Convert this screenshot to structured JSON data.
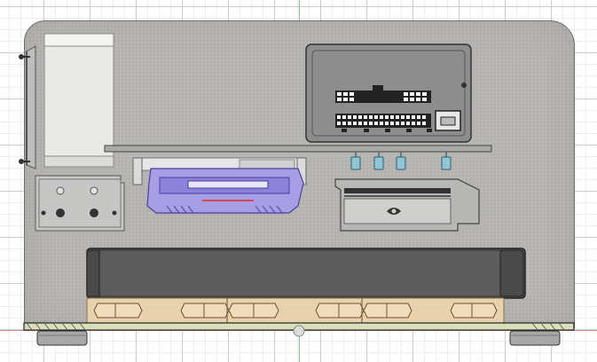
{
  "viewport": {
    "background": "#ffffff",
    "grid_major": "#c9ccd0",
    "grid_minor": "#eceef0"
  },
  "axes": {
    "vertical_color": "#7fd18a",
    "horizontal_color": "#e58b8b"
  },
  "colors": {
    "case_panel": "#b8b6b2",
    "psu": "#8d8d8d",
    "gpu_body": "#555555",
    "ram_purple": "#a79ee6",
    "fan_strip": "#e8d2ae",
    "connector_blue": "#8fc6d6",
    "foot": "#a8a8a8"
  },
  "components": {
    "case": "case-panel",
    "psu": "power-supply",
    "motherboard": "motherboard-tray",
    "ram": "ram-heatsink",
    "gpu_card": "graphics-card",
    "radiator": "radiator",
    "fans": "fan-row",
    "cylinder": "reservoir-tube",
    "mount": "pump-bracket"
  }
}
